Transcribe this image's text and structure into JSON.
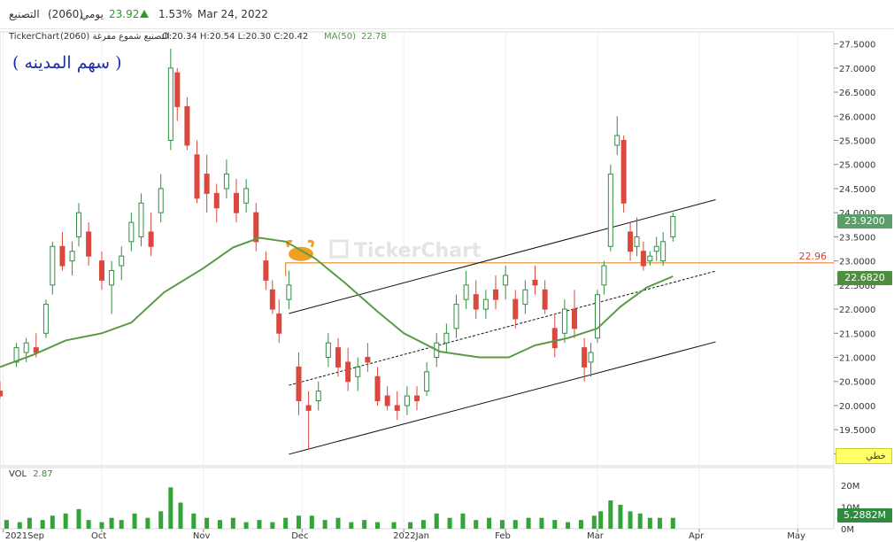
{
  "header": {
    "name": "التصنيع",
    "code": "(2060)",
    "period": "يومي",
    "last": "23.92",
    "change": "1.53%",
    "date": "Mar 24, 2022"
  },
  "info": {
    "brand": "TickerChart",
    "desc": "التصنيع شموع مفرغة (2060)",
    "ohlc": "O:20.34 H:20.54 L:20.30 C:20.42",
    "ma_label": "MA(50)",
    "ma_value": "22.78"
  },
  "annotation": "(   سهم المدينه   )",
  "watermark": "TickerChart",
  "hline_label": "22.96",
  "last_tag": "23.9200",
  "ma_tag": "22.6820",
  "lines_label": "خطي",
  "vol": {
    "label": "VOL",
    "value": "2.87",
    "tag": "5.2882M"
  },
  "colors": {
    "up": "#2f8f3f",
    "down": "#d9493e",
    "ma": "#5a9a45",
    "hline": "#e38a2a"
  },
  "chart_data": {
    "type": "candlestick",
    "price_ticks": [
      "27.5000",
      "27.0000",
      "26.5000",
      "26.0000",
      "25.5000",
      "25.0000",
      "24.5000",
      "24.0000",
      "23.5000",
      "23.0000",
      "22.5000",
      "22.0000",
      "21.5000",
      "21.0000",
      "20.5000",
      "20.0000",
      "19.5000",
      "19.0000"
    ],
    "ylim": [
      18.75,
      27.75
    ],
    "xlim": [
      "2021-08-31",
      "2022-05-12"
    ],
    "x_ticks": [
      {
        "label": "2021Sep",
        "date": "2021-09-01"
      },
      {
        "label": "Oct",
        "date": "2021-10-01"
      },
      {
        "label": "Nov",
        "date": "2021-11-01"
      },
      {
        "label": "Dec",
        "date": "2021-12-01"
      },
      {
        "label": "2022Jan",
        "date": "2022-01-01"
      },
      {
        "label": "Feb",
        "date": "2022-02-01"
      },
      {
        "label": "Mar",
        "date": "2022-03-01"
      },
      {
        "label": "Apr",
        "date": "2022-04-01"
      },
      {
        "label": "May",
        "date": "2022-05-01"
      }
    ],
    "horizontal_line": {
      "value": 22.96,
      "from": "2021-11-26"
    },
    "channel": [
      {
        "from": [
          "2021-11-27",
          18.99
        ],
        "to": [
          "2022-04-06",
          21.32
        ]
      },
      {
        "from": [
          "2021-11-27",
          21.91
        ],
        "to": [
          "2022-04-06",
          24.27
        ]
      },
      {
        "from": [
          "2021-11-27",
          20.42
        ],
        "to": [
          "2022-04-06",
          22.79
        ]
      }
    ],
    "ma50": [
      [
        "2021-08-31",
        20.8
      ],
      [
        "2021-09-10",
        21.05
      ],
      [
        "2021-09-20",
        21.35
      ],
      [
        "2021-10-01",
        21.5
      ],
      [
        "2021-10-10",
        21.72
      ],
      [
        "2021-10-20",
        22.35
      ],
      [
        "2021-11-01",
        22.85
      ],
      [
        "2021-11-10",
        23.28
      ],
      [
        "2021-11-18",
        23.48
      ],
      [
        "2021-11-26",
        23.4
      ],
      [
        "2021-12-05",
        23.05
      ],
      [
        "2021-12-14",
        22.55
      ],
      [
        "2021-12-24",
        21.95
      ],
      [
        "2022-01-01",
        21.5
      ],
      [
        "2022-01-12",
        21.12
      ],
      [
        "2022-01-24",
        21.0
      ],
      [
        "2022-02-02",
        21.0
      ],
      [
        "2022-02-10",
        21.25
      ],
      [
        "2022-02-20",
        21.4
      ],
      [
        "2022-03-01",
        21.6
      ],
      [
        "2022-03-08",
        22.05
      ],
      [
        "2022-03-16",
        22.45
      ],
      [
        "2022-03-24",
        22.68
      ]
    ],
    "candles": [
      [
        "2021-08-31",
        20.3,
        20.5,
        20.15,
        20.2
      ],
      [
        "2021-09-05",
        20.9,
        21.3,
        20.8,
        21.2
      ],
      [
        "2021-09-08",
        21.1,
        21.4,
        20.9,
        21.3
      ],
      [
        "2021-09-11",
        21.2,
        21.5,
        21.0,
        21.1
      ],
      [
        "2021-09-14",
        21.5,
        22.2,
        21.4,
        22.1
      ],
      [
        "2021-09-16",
        22.5,
        23.4,
        22.3,
        23.3
      ],
      [
        "2021-09-19",
        23.3,
        23.6,
        22.8,
        22.9
      ],
      [
        "2021-09-22",
        23.0,
        23.4,
        22.7,
        23.2
      ],
      [
        "2021-09-24",
        23.5,
        24.2,
        23.3,
        24.0
      ],
      [
        "2021-09-27",
        23.6,
        23.8,
        22.9,
        23.1
      ],
      [
        "2021-10-01",
        23.0,
        23.2,
        22.4,
        22.6
      ],
      [
        "2021-10-04",
        22.5,
        23.0,
        21.9,
        22.8
      ],
      [
        "2021-10-07",
        22.9,
        23.3,
        22.6,
        23.1
      ],
      [
        "2021-10-10",
        23.4,
        24.0,
        23.2,
        23.8
      ],
      [
        "2021-10-13",
        23.5,
        24.4,
        23.3,
        24.2
      ],
      [
        "2021-10-16",
        23.6,
        24.0,
        23.1,
        23.3
      ],
      [
        "2021-10-19",
        24.0,
        24.8,
        23.8,
        24.5
      ],
      [
        "2021-10-22",
        25.5,
        27.4,
        25.3,
        27.0
      ],
      [
        "2021-10-24",
        26.9,
        27.0,
        25.9,
        26.2
      ],
      [
        "2021-10-27",
        26.2,
        26.4,
        25.3,
        25.4
      ],
      [
        "2021-10-30",
        25.2,
        25.5,
        24.2,
        24.3
      ],
      [
        "2021-11-02",
        24.8,
        25.2,
        24.0,
        24.4
      ],
      [
        "2021-11-05",
        24.4,
        24.6,
        23.8,
        24.1
      ],
      [
        "2021-11-08",
        24.5,
        25.1,
        24.3,
        24.8
      ],
      [
        "2021-11-11",
        24.4,
        24.7,
        23.8,
        24.0
      ],
      [
        "2021-11-14",
        24.2,
        24.7,
        24.0,
        24.5
      ],
      [
        "2021-11-17",
        24.0,
        24.2,
        23.2,
        23.4
      ],
      [
        "2021-11-20",
        23.0,
        23.2,
        22.4,
        22.6
      ],
      [
        "2021-11-22",
        22.4,
        22.6,
        21.9,
        22.0
      ],
      [
        "2021-11-24",
        21.9,
        22.2,
        21.3,
        21.5
      ],
      [
        "2021-11-27",
        22.2,
        22.8,
        22.0,
        22.5
      ],
      [
        "2021-11-30",
        20.8,
        21.1,
        19.8,
        20.1
      ],
      [
        "2021-12-03",
        20.0,
        20.3,
        19.1,
        19.9
      ],
      [
        "2021-12-06",
        20.1,
        20.5,
        19.9,
        20.3
      ],
      [
        "2021-12-09",
        21.0,
        21.5,
        20.8,
        21.3
      ],
      [
        "2021-12-12",
        21.2,
        21.4,
        20.6,
        20.8
      ],
      [
        "2021-12-15",
        20.9,
        21.2,
        20.3,
        20.5
      ],
      [
        "2021-12-18",
        20.6,
        21.0,
        20.3,
        20.8
      ],
      [
        "2021-12-21",
        21.0,
        21.3,
        20.7,
        20.9
      ],
      [
        "2021-12-24",
        20.6,
        20.8,
        20.0,
        20.1
      ],
      [
        "2021-12-27",
        20.2,
        20.4,
        19.9,
        20.0
      ],
      [
        "2021-12-30",
        20.0,
        20.3,
        19.7,
        19.9
      ],
      [
        "2022-01-02",
        20.0,
        20.4,
        19.8,
        20.2
      ],
      [
        "2022-01-05",
        20.2,
        20.4,
        19.9,
        20.1
      ],
      [
        "2022-01-08",
        20.3,
        20.9,
        20.2,
        20.7
      ],
      [
        "2022-01-11",
        21.0,
        21.5,
        20.8,
        21.3
      ],
      [
        "2022-01-14",
        21.3,
        21.7,
        21.1,
        21.5
      ],
      [
        "2022-01-17",
        21.6,
        22.3,
        21.4,
        22.1
      ],
      [
        "2022-01-20",
        22.2,
        22.8,
        22.0,
        22.5
      ],
      [
        "2022-01-23",
        22.3,
        22.6,
        21.8,
        22.0
      ],
      [
        "2022-01-26",
        22.0,
        22.4,
        21.8,
        22.2
      ],
      [
        "2022-01-29",
        22.4,
        22.7,
        22.0,
        22.2
      ],
      [
        "2022-02-01",
        22.5,
        22.9,
        22.2,
        22.7
      ],
      [
        "2022-02-04",
        22.2,
        22.4,
        21.6,
        21.8
      ],
      [
        "2022-02-07",
        22.1,
        22.6,
        21.9,
        22.4
      ],
      [
        "2022-02-10",
        22.6,
        22.9,
        22.3,
        22.5
      ],
      [
        "2022-02-13",
        22.4,
        22.6,
        21.9,
        22.0
      ],
      [
        "2022-02-16",
        21.6,
        21.9,
        21.0,
        21.2
      ],
      [
        "2022-02-19",
        21.5,
        22.2,
        21.3,
        22.0
      ],
      [
        "2022-02-22",
        22.0,
        22.4,
        21.4,
        21.6
      ],
      [
        "2022-02-25",
        21.2,
        21.4,
        20.5,
        20.8
      ],
      [
        "2022-02-27",
        20.9,
        21.3,
        20.6,
        21.1
      ],
      [
        "2022-03-01",
        21.4,
        22.4,
        21.3,
        22.3
      ],
      [
        "2022-03-03",
        22.5,
        23.0,
        22.3,
        22.9
      ],
      [
        "2022-03-05",
        23.3,
        25.0,
        23.2,
        24.8
      ],
      [
        "2022-03-07",
        25.4,
        26.0,
        25.2,
        25.6
      ],
      [
        "2022-03-09",
        25.5,
        25.6,
        24.0,
        24.2
      ],
      [
        "2022-03-11",
        23.6,
        23.8,
        23.0,
        23.2
      ],
      [
        "2022-03-13",
        23.3,
        23.9,
        23.1,
        23.5
      ],
      [
        "2022-03-15",
        23.2,
        23.4,
        22.8,
        22.9
      ],
      [
        "2022-03-17",
        23.0,
        23.2,
        22.9,
        23.1
      ],
      [
        "2022-03-19",
        23.2,
        23.5,
        23.0,
        23.3
      ],
      [
        "2022-03-21",
        23.0,
        23.6,
        22.9,
        23.4
      ],
      [
        "2022-03-24",
        23.5,
        24.0,
        23.4,
        23.92
      ]
    ],
    "volume_ticks": [
      "20M",
      "10M",
      "0M"
    ],
    "volume_ylim": [
      0,
      24
    ],
    "volume": [
      [
        "2021-09-02",
        4
      ],
      [
        "2021-09-06",
        3
      ],
      [
        "2021-09-09",
        5
      ],
      [
        "2021-09-13",
        4
      ],
      [
        "2021-09-16",
        6
      ],
      [
        "2021-09-20",
        7
      ],
      [
        "2021-09-24",
        9
      ],
      [
        "2021-09-27",
        4
      ],
      [
        "2021-10-01",
        3
      ],
      [
        "2021-10-04",
        5
      ],
      [
        "2021-10-07",
        4
      ],
      [
        "2021-10-11",
        7
      ],
      [
        "2021-10-15",
        5
      ],
      [
        "2021-10-19",
        8
      ],
      [
        "2021-10-22",
        19
      ],
      [
        "2021-10-25",
        12
      ],
      [
        "2021-10-29",
        7
      ],
      [
        "2021-11-02",
        5
      ],
      [
        "2021-11-06",
        4
      ],
      [
        "2021-11-10",
        5
      ],
      [
        "2021-11-14",
        3
      ],
      [
        "2021-11-18",
        4
      ],
      [
        "2021-11-22",
        3
      ],
      [
        "2021-11-26",
        5
      ],
      [
        "2021-11-30",
        6
      ],
      [
        "2021-12-04",
        6
      ],
      [
        "2021-12-08",
        4
      ],
      [
        "2021-12-12",
        5
      ],
      [
        "2021-12-16",
        3
      ],
      [
        "2021-12-20",
        4
      ],
      [
        "2021-12-24",
        3
      ],
      [
        "2021-12-29",
        3
      ],
      [
        "2022-01-03",
        3
      ],
      [
        "2022-01-07",
        4
      ],
      [
        "2022-01-11",
        7
      ],
      [
        "2022-01-15",
        5
      ],
      [
        "2022-01-19",
        7
      ],
      [
        "2022-01-23",
        4
      ],
      [
        "2022-01-27",
        5
      ],
      [
        "2022-01-31",
        4
      ],
      [
        "2022-02-04",
        4
      ],
      [
        "2022-02-08",
        5
      ],
      [
        "2022-02-12",
        5
      ],
      [
        "2022-02-16",
        4
      ],
      [
        "2022-02-20",
        3
      ],
      [
        "2022-02-24",
        4
      ],
      [
        "2022-02-28",
        6
      ],
      [
        "2022-03-02",
        8
      ],
      [
        "2022-03-05",
        13
      ],
      [
        "2022-03-08",
        11
      ],
      [
        "2022-03-11",
        8
      ],
      [
        "2022-03-14",
        7
      ],
      [
        "2022-03-17",
        5
      ],
      [
        "2022-03-20",
        5
      ],
      [
        "2022-03-24",
        5
      ]
    ]
  }
}
